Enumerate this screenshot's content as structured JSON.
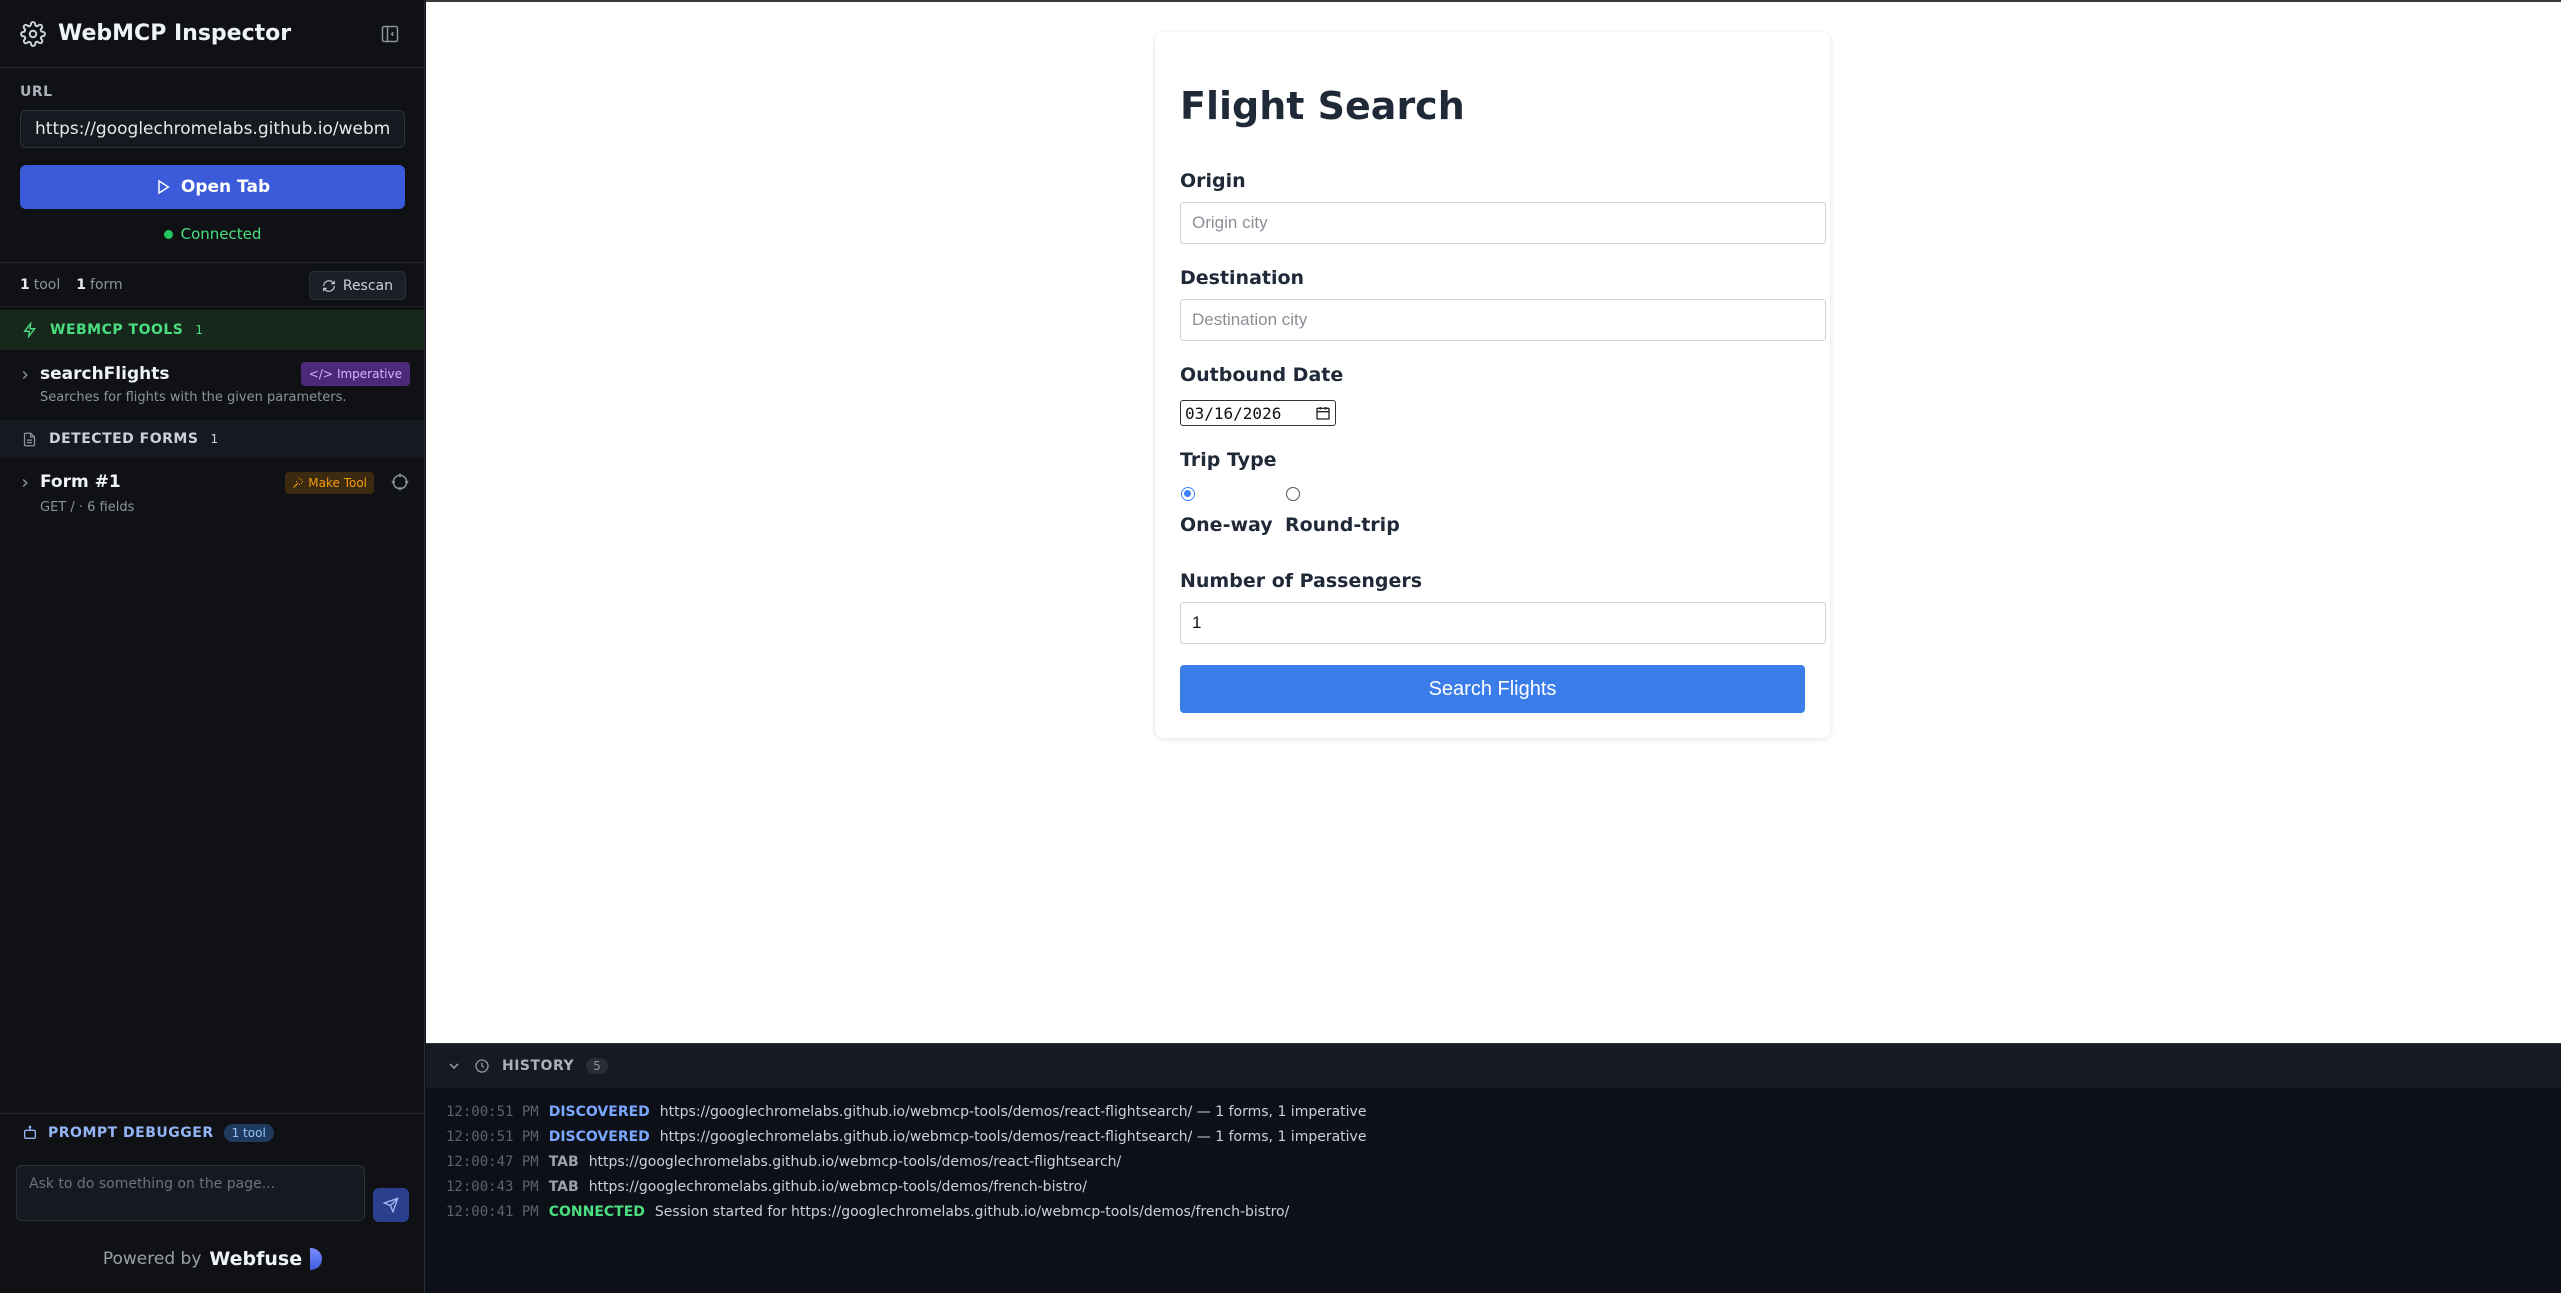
{
  "sidebar": {
    "title": "WebMCP Inspector",
    "url_label": "URL",
    "url_value": "https://googlechromelabs.github.io/webmcp-tools/demos/react-flightsearch/",
    "open_tab_label": "Open Tab",
    "status": "Connected",
    "counts": {
      "tools_num": "1",
      "tools_word": "tool",
      "forms_num": "1",
      "forms_word": "form"
    },
    "rescan_label": "Rescan",
    "tools_section": {
      "title": "WEBMCP TOOLS",
      "count": "1"
    },
    "tools": [
      {
        "name": "searchFlights",
        "description": "Searches for flights with the given parameters.",
        "badge": "Imperative"
      }
    ],
    "forms_section": {
      "title": "DETECTED FORMS",
      "count": "1"
    },
    "forms": [
      {
        "name": "Form #1",
        "meta": "GET / · 6 fields",
        "make_tool_label": "Make Tool"
      }
    ],
    "prompt": {
      "title": "PROMPT DEBUGGER",
      "badge": "1 tool",
      "placeholder": "Ask to do something on the page..."
    },
    "powered_by": "Powered by",
    "brand": "Webfuse"
  },
  "page": {
    "title": "Flight Search",
    "origin_label": "Origin",
    "origin_placeholder": "Origin city",
    "destination_label": "Destination",
    "destination_placeholder": "Destination city",
    "date_label": "Outbound Date",
    "date_value": "03/16/2026",
    "trip_type_label": "Trip Type",
    "trip_options": [
      "One-way",
      "Round-trip"
    ],
    "trip_selected": "One-way",
    "passengers_label": "Number of Passengers",
    "passengers_value": "1",
    "search_button": "Search Flights"
  },
  "history": {
    "title": "HISTORY",
    "count": "5",
    "entries": [
      {
        "time": "12:00:51 PM",
        "kind": "DISCOVERED",
        "message": "https://googlechromelabs.github.io/webmcp-tools/demos/react-flightsearch/ — 1 forms, 1 imperative"
      },
      {
        "time": "12:00:51 PM",
        "kind": "DISCOVERED",
        "message": "https://googlechromelabs.github.io/webmcp-tools/demos/react-flightsearch/ — 1 forms, 1 imperative"
      },
      {
        "time": "12:00:47 PM",
        "kind": "TAB",
        "message": "https://googlechromelabs.github.io/webmcp-tools/demos/react-flightsearch/"
      },
      {
        "time": "12:00:43 PM",
        "kind": "TAB",
        "message": "https://googlechromelabs.github.io/webmcp-tools/demos/french-bistro/"
      },
      {
        "time": "12:00:41 PM",
        "kind": "CONNECTED",
        "message": "Session started for https://googlechromelabs.github.io/webmcp-tools/demos/french-bistro/"
      }
    ]
  },
  "colors": {
    "accent": "#3b5bdb",
    "connected": "#22c55e",
    "imperative_badge": "#4b2a7a",
    "make_tool": "#f59e0b",
    "search_button": "#3b7de8"
  }
}
